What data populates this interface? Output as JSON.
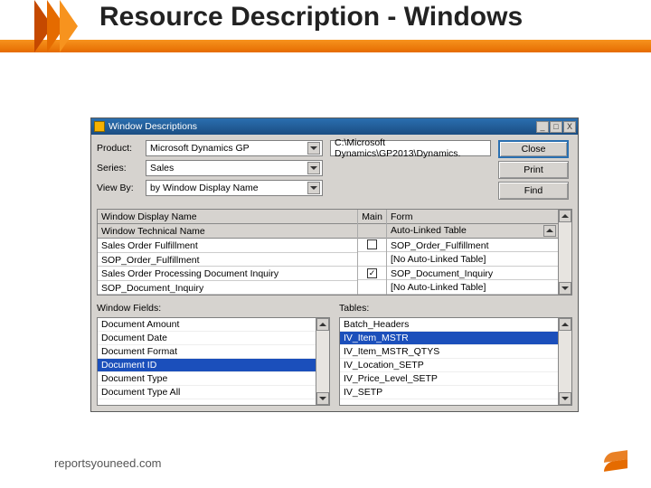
{
  "slide": {
    "title": "Resource Description - Windows",
    "footer": "reportsyouneed.com"
  },
  "dialog": {
    "title": "Window Descriptions",
    "winbtns": {
      "min": "_",
      "max": "□",
      "close": "X"
    },
    "labels": {
      "product": "Product:",
      "series": "Series:",
      "view": "View By:"
    },
    "values": {
      "product": "Microsoft Dynamics GP",
      "series": "Sales",
      "view": "by Window Display Name",
      "path": "C:\\Microsoft Dynamics\\GP2013\\Dynamics."
    },
    "buttons": {
      "close": "Close",
      "print": "Print",
      "find": "Find"
    },
    "grid": {
      "headers": {
        "display": "Window Display Name",
        "technical": "Window Technical Name",
        "main": "Main",
        "form": "Form",
        "autolinked": "Auto-Linked Table"
      },
      "rows": [
        {
          "display": "Sales Order Fulfillment",
          "technical": "SOP_Order_Fulfillment",
          "hasCb": true,
          "checked": false,
          "form": "SOP_Order_Fulfillment",
          "auto": "[No Auto-Linked Table]"
        },
        {
          "display": "Sales Order Processing Document Inquiry",
          "technical": "SOP_Document_Inquiry",
          "hasCb": true,
          "checked": true,
          "form": "SOP_Document_Inquiry",
          "auto": "[No Auto-Linked Table]"
        }
      ]
    },
    "fields": {
      "label": "Window Fields:",
      "items": [
        "Document Amount",
        "Document Date",
        "Document Format",
        "Document ID",
        "Document Type",
        "Document Type All"
      ],
      "selected": "Document ID"
    },
    "tables": {
      "label": "Tables:",
      "items": [
        "Batch_Headers",
        "IV_Item_MSTR",
        "IV_Item_MSTR_QTYS",
        "IV_Location_SETP",
        "IV_Price_Level_SETP",
        "IV_SETP"
      ],
      "selected": "IV_Item_MSTR"
    }
  }
}
